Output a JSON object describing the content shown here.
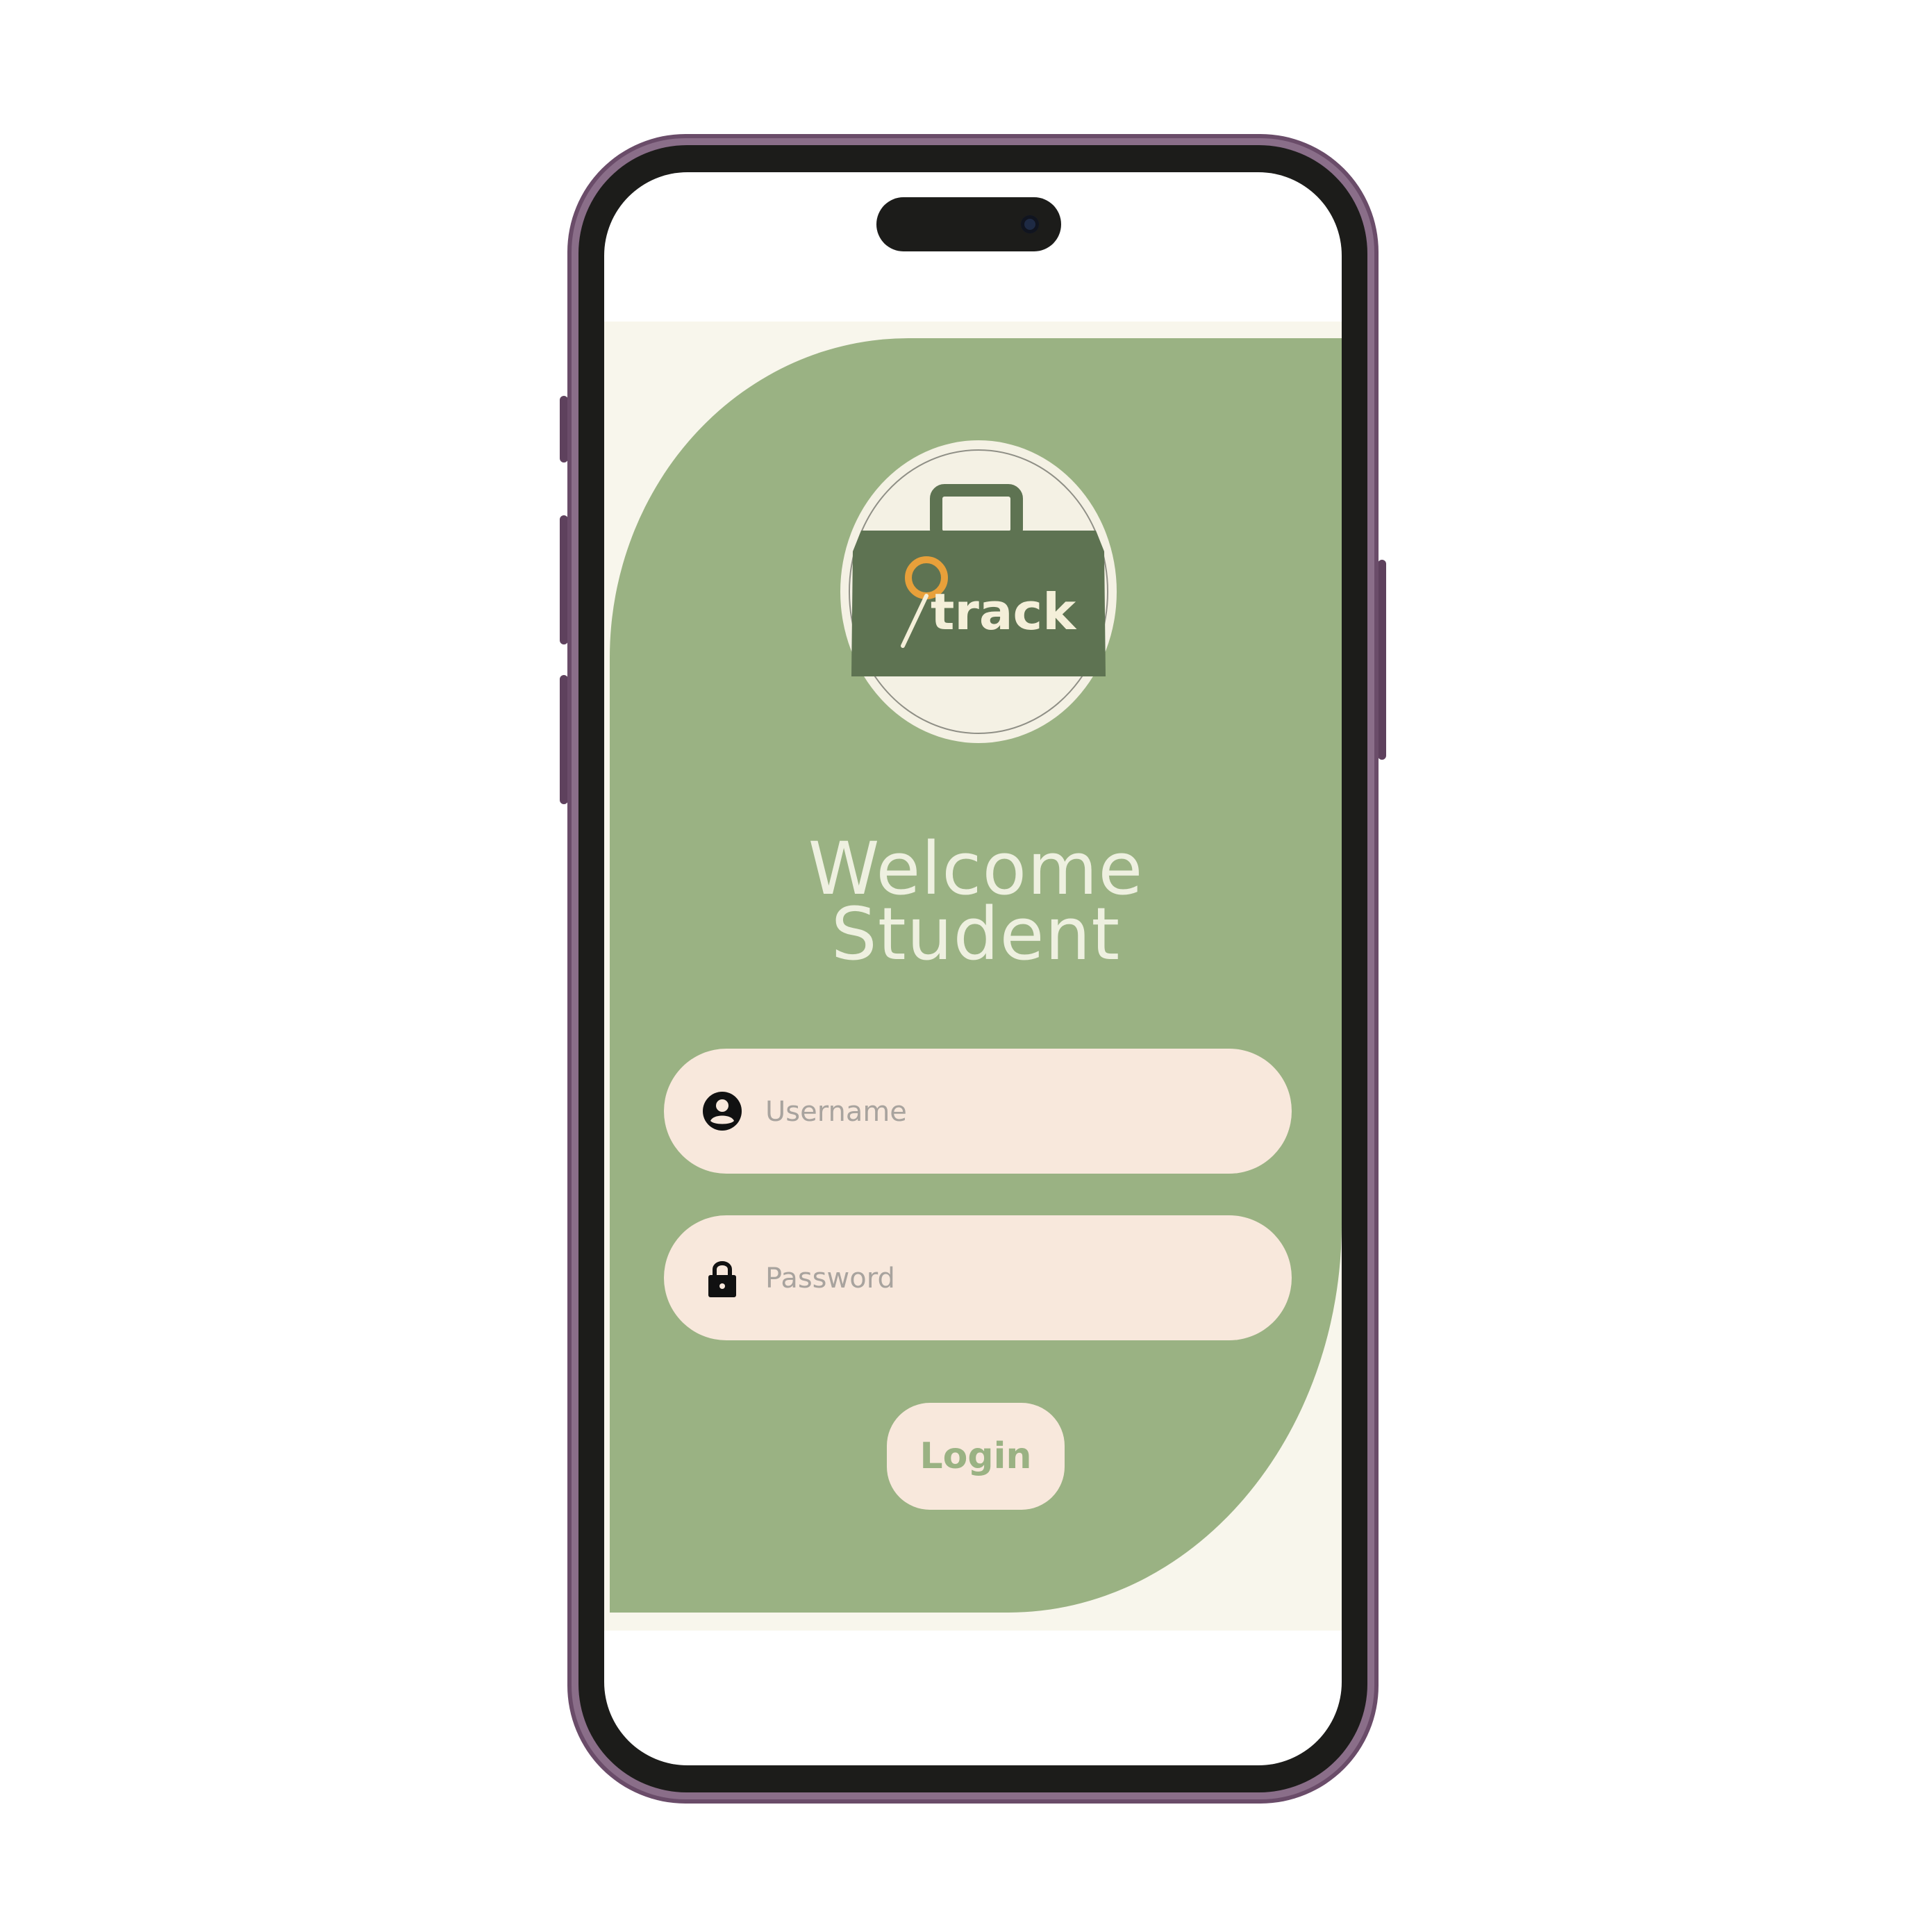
{
  "app": {
    "logo_text": "track",
    "welcome_line1": "Welcome",
    "welcome_line2": "Student"
  },
  "form": {
    "username": {
      "placeholder": "Username",
      "value": "",
      "icon": "user-circle-icon"
    },
    "password": {
      "placeholder": "Password",
      "value": "",
      "icon": "lock-icon"
    },
    "login_label": "Login"
  },
  "colors": {
    "panel_green": "#9ab283",
    "logo_dark_green": "#5e7352",
    "field_bg": "#f8e8dc",
    "logo_accent": "#e8a03a",
    "background_cream": "#f8f6ec"
  }
}
